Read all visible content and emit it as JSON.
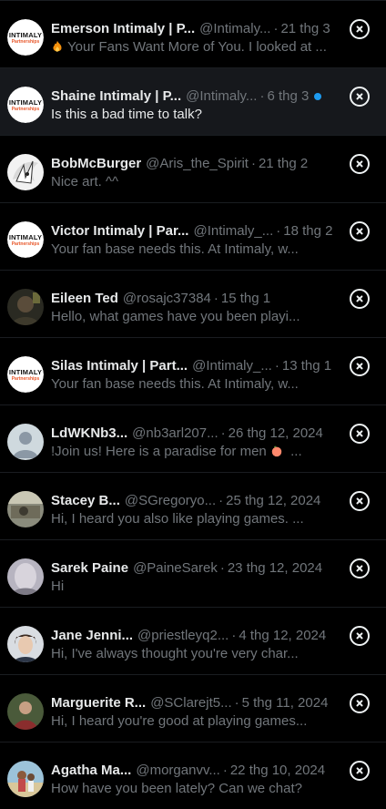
{
  "conversations": [
    {
      "name": "Emerson Intimaly | P...",
      "handle": "@Intimaly...",
      "date": "21 thg 3",
      "preview": "Your Fans Want More of You. I looked at ...",
      "avatar": "intimaly-logo",
      "emoji": "fire-emoji",
      "unread": false,
      "highlight": false,
      "bold": false
    },
    {
      "name": "Shaine Intimaly | P...",
      "handle": "@Intimaly...",
      "date": "6 thg 3",
      "preview": "Is this a bad time to talk?",
      "avatar": "intimaly-logo",
      "unread": true,
      "highlight": true,
      "bold": true
    },
    {
      "name": "BobMcBurger",
      "handle": "@Aris_the_Spirit",
      "date": "21 thg 2",
      "preview": "Nice art. ^^",
      "avatar": "anime-art",
      "unread": false,
      "highlight": false,
      "bold": false
    },
    {
      "name": "Victor Intimaly | Par...",
      "handle": "@Intimaly_...",
      "date": "18 thg 2",
      "preview": "Your fan base needs this. At Intimaly, w...",
      "avatar": "intimaly-logo",
      "unread": false,
      "highlight": false,
      "bold": false
    },
    {
      "name": "Eileen Ted",
      "handle": "@rosajc37384",
      "date": "15 thg 1",
      "preview": "Hello, what games have you been playi...",
      "avatar": "photo-dark",
      "unread": false,
      "highlight": false,
      "bold": false
    },
    {
      "name": "Silas Intimaly | Part...",
      "handle": "@Intimaly_...",
      "date": "13 thg 1",
      "preview": "Your fan base needs this. At Intimaly, w...",
      "avatar": "intimaly-logo",
      "unread": false,
      "highlight": false,
      "bold": false
    },
    {
      "name": "LdWKNb3...",
      "handle": "@nb3arl207...",
      "date": "26 thg 12, 2024",
      "preview": "!Join us! Here is a paradise for men",
      "avatar": "default-avatar",
      "emoji_after": "peach-emoji",
      "unread": false,
      "highlight": false,
      "bold": false
    },
    {
      "name": "Stacey B...",
      "handle": "@SGregoryo...",
      "date": "25 thg 12, 2024",
      "preview": "Hi, I heard you also like playing games. ...",
      "avatar": "photo-outdoor",
      "unread": false,
      "highlight": false,
      "bold": false
    },
    {
      "name": "Sarek Paine",
      "handle": "@PaineSarek",
      "date": "23 thg 12, 2024",
      "preview": "Hi",
      "avatar": "photo-soft",
      "unread": false,
      "highlight": false,
      "bold": false
    },
    {
      "name": "Jane Jenni...",
      "handle": "@priestleyq2...",
      "date": "4 thg 12, 2024",
      "preview": "Hi, I've always thought you're very char...",
      "avatar": "photo-portrait",
      "unread": false,
      "highlight": false,
      "bold": false
    },
    {
      "name": "Marguerite R...",
      "handle": "@SClarejt5...",
      "date": "5 thg 11, 2024",
      "preview": "Hi, I heard you're good at playing games...",
      "avatar": "photo-green",
      "unread": false,
      "highlight": false,
      "bold": false
    },
    {
      "name": "Agatha Ma...",
      "handle": "@morganvv...",
      "date": "22 thg 10, 2024",
      "preview": "How have you been lately? Can we chat?",
      "avatar": "photo-beach",
      "unread": false,
      "highlight": false,
      "bold": false
    }
  ],
  "logo_text": {
    "line1": "INTIMALY",
    "line2": "Partnerships"
  },
  "separator": "·",
  "colors": {
    "background": "#000000",
    "highlight": "#16181c",
    "primary_text": "#e7e9ea",
    "secondary_text": "#71767b",
    "unread_dot": "#1d9bf0",
    "logo_accent": "#e8572a"
  }
}
